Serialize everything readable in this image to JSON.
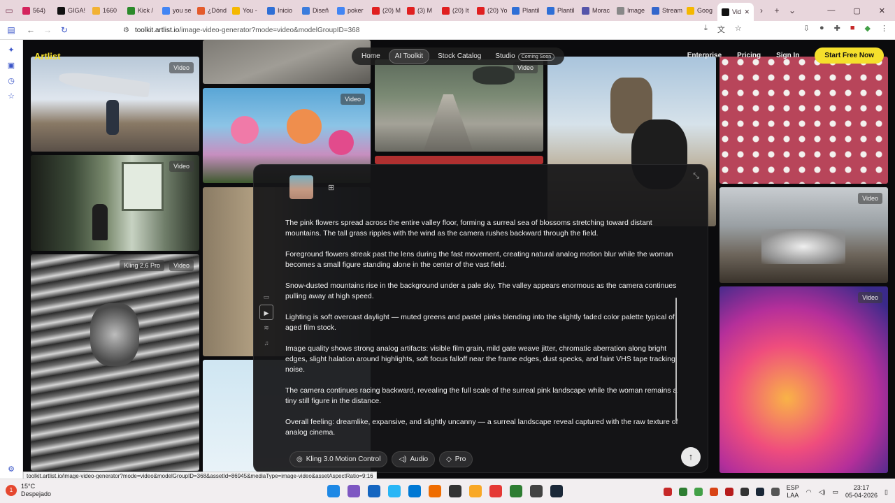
{
  "browser": {
    "tabs": [
      {
        "label": "564)",
        "color": "#d4245d"
      },
      {
        "label": "GIGA!",
        "color": "#111111"
      },
      {
        "label": "1660",
        "color": "#f2b233"
      },
      {
        "label": "Kick /",
        "color": "#2b8a2b"
      },
      {
        "label": "you se",
        "color": "#4285f4"
      },
      {
        "label": "¿Dónd",
        "color": "#e45b2c"
      },
      {
        "label": "You -",
        "color": "#f5b800"
      },
      {
        "label": "Inicio",
        "color": "#2e6fd6"
      },
      {
        "label": "Diseñ",
        "color": "#3b7ddd"
      },
      {
        "label": "poker",
        "color": "#4285f4"
      },
      {
        "label": "(20) M",
        "color": "#e02020"
      },
      {
        "label": "(3) M",
        "color": "#e02020"
      },
      {
        "label": "(20) It",
        "color": "#e02020"
      },
      {
        "label": "(20) Yo",
        "color": "#e02020"
      },
      {
        "label": "Plantil",
        "color": "#2e6fd6"
      },
      {
        "label": "Plantil",
        "color": "#2e6fd6"
      },
      {
        "label": "Morac",
        "color": "#5555aa"
      },
      {
        "label": "Image",
        "color": "#888888"
      },
      {
        "label": "Stream",
        "color": "#3366cc"
      },
      {
        "label": "Goog",
        "color": "#f5b800"
      }
    ],
    "active_tab": {
      "label": "Vid",
      "color": "#111111"
    },
    "url_host": "toolkit.artlist.io",
    "url_path": "/image-video-generator?mode=video&modelGroupID=368"
  },
  "site": {
    "logo": "Artlist",
    "nav": {
      "home": "Home",
      "ai_toolkit": "AI Toolkit",
      "stock": "Stock Catalog",
      "studio": "Studio",
      "coming_soon": "Coming Soon"
    },
    "right": {
      "enterprise": "Enterprise",
      "pricing": "Pricing",
      "signin": "Sign In",
      "cta": "Start Free Now"
    },
    "badge_video": "Video",
    "badge_kling": "Kling 2.6 Pro"
  },
  "prompt": {
    "paragraphs": [
      "The pink flowers spread across the entire valley floor, forming a surreal sea of blossoms stretching toward distant mountains. The tall grass ripples with the wind as the camera rushes backward through the field.",
      "Foreground flowers streak past the lens during the fast movement, creating natural analog motion blur while the woman becomes a small figure standing alone in the center of the vast field.",
      "Snow-dusted mountains rise in the background under a pale sky. The valley appears enormous as the camera continues pulling away at high speed.",
      "Lighting is soft overcast daylight — muted greens and pastel pinks blending into the slightly faded color palette typical of aged film stock.",
      "Image quality shows strong analog artifacts: visible film grain, mild gate weave jitter, chromatic aberration along bright edges, slight halation around highlights, soft focus falloff near the frame edges, dust specks, and faint VHS tape tracking noise.",
      "The camera continues racing backward, revealing the full scale of the surreal pink landscape while the woman remains a tiny still figure in the distance.",
      "Overall feeling: dreamlike, expansive, and slightly uncanny — a surreal landscape reveal captured with the raw texture of analog cinema."
    ],
    "chips": {
      "model": "Kling 3.0 Motion Control",
      "audio": "Audio",
      "pro": "Pro"
    }
  },
  "status_url": "toolkit.artlist.io/image-video-generator?mode=video&modelGroupID=368&assetId=86945&mediaType=image-video&assetAspectRatio=9:16",
  "taskbar": {
    "weather_badge": "1",
    "temp": "15°C",
    "weather": "Despejado",
    "lang_top": "ESP",
    "lang_bottom": "LAA",
    "time": "23:17",
    "date": "05-04-2026",
    "app_colors": [
      "#1e88e5",
      "#7e57c2",
      "#1565c0",
      "#29b6f6",
      "#0078d4",
      "#ef6c00",
      "#333333",
      "#f9a825",
      "#e53935",
      "#2e7d32",
      "#424242",
      "#1b2838"
    ],
    "tray_colors": [
      "#c62828",
      "#2e7d32",
      "#43a047",
      "#d84315",
      "#b71c1c",
      "#333333",
      "#1b2838",
      "#555555"
    ]
  }
}
